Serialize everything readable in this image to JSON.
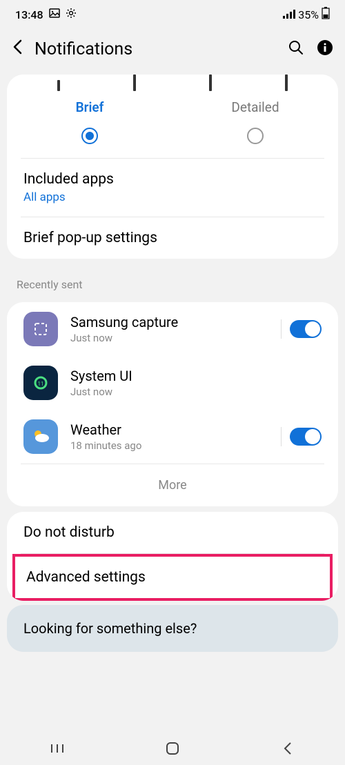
{
  "status": {
    "time": "13:48",
    "battery": "35%"
  },
  "header": {
    "title": "Notifications"
  },
  "style": {
    "brief": "Brief",
    "detailed": "Detailed",
    "selected": "brief"
  },
  "included": {
    "title": "Included apps",
    "value": "All apps"
  },
  "popup": {
    "title": "Brief pop-up settings"
  },
  "recent": {
    "label": "Recently sent",
    "apps": [
      {
        "name": "Samsung capture",
        "time": "Just now",
        "toggle": true
      },
      {
        "name": "System UI",
        "time": "Just now",
        "toggle": false
      },
      {
        "name": "Weather",
        "time": "18 minutes ago",
        "toggle": true
      }
    ],
    "more": "More"
  },
  "dnd": {
    "title": "Do not disturb"
  },
  "advanced": {
    "title": "Advanced settings"
  },
  "footer": {
    "prompt": "Looking for something else?"
  }
}
